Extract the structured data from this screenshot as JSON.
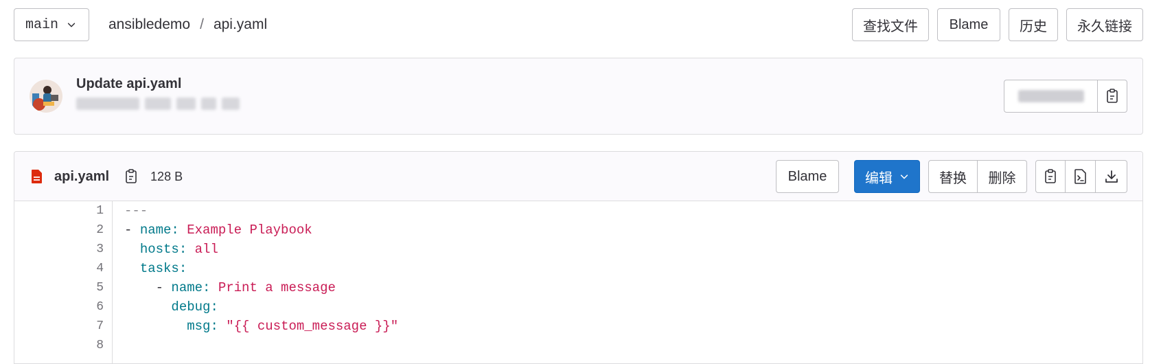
{
  "top": {
    "branch": "main",
    "breadcrumb": [
      "ansibledemo",
      "api.yaml"
    ],
    "breadcrumb_separator": "/",
    "actions": [
      "查找文件",
      "Blame",
      "历史",
      "永久链接"
    ]
  },
  "commit": {
    "title": "Update api.yaml",
    "avatar_icon": "user-avatar"
  },
  "file": {
    "name": "api.yaml",
    "size": "128 B",
    "file_icon": "file-icon",
    "blame_label": "Blame",
    "edit_label": "编辑",
    "replace_label": "替换",
    "delete_label": "删除",
    "colors": {
      "primary": "#1f75cb",
      "key": "#00798a",
      "value": "#c91c55",
      "file_icon": "#dd2b0e"
    }
  },
  "code": {
    "lines": [
      {
        "n": "1",
        "indent": "",
        "dash": "",
        "key": "",
        "colon": "",
        "value": "",
        "comment": "---"
      },
      {
        "n": "2",
        "indent": "",
        "dash": "- ",
        "key": "name",
        "colon": ": ",
        "value": "Example Playbook",
        "comment": ""
      },
      {
        "n": "3",
        "indent": "  ",
        "dash": "",
        "key": "hosts",
        "colon": ": ",
        "value": "all",
        "comment": ""
      },
      {
        "n": "4",
        "indent": "  ",
        "dash": "",
        "key": "tasks",
        "colon": ":",
        "value": "",
        "comment": ""
      },
      {
        "n": "5",
        "indent": "    ",
        "dash": "- ",
        "key": "name",
        "colon": ": ",
        "value": "Print a message",
        "comment": ""
      },
      {
        "n": "6",
        "indent": "      ",
        "dash": "",
        "key": "debug",
        "colon": ":",
        "value": "",
        "comment": ""
      },
      {
        "n": "7",
        "indent": "        ",
        "dash": "",
        "key": "msg",
        "colon": ": ",
        "value": "\"{{ custom_message }}\"",
        "comment": ""
      },
      {
        "n": "8",
        "indent": "",
        "dash": "",
        "key": "",
        "colon": "",
        "value": "",
        "comment": ""
      }
    ]
  }
}
